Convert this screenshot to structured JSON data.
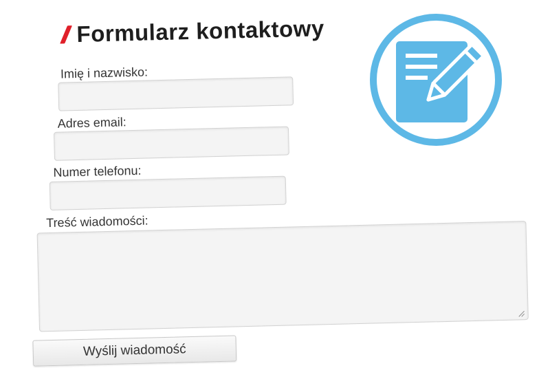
{
  "form": {
    "title": "Formularz kontaktowy",
    "fields": [
      {
        "label": "Imię i nazwisko:",
        "value": "",
        "placeholder": ""
      },
      {
        "label": "Adres email:",
        "value": "",
        "placeholder": ""
      },
      {
        "label": "Numer telefonu:",
        "value": "",
        "placeholder": ""
      }
    ],
    "message": {
      "label": "Treść wiadomości:",
      "value": ""
    },
    "submit_label": "Wyślij wiadomość"
  },
  "colors": {
    "accent": "#e0202a",
    "badge_blue": "#5db8e6"
  },
  "icons": {
    "badge": "form-pencil-icon"
  }
}
